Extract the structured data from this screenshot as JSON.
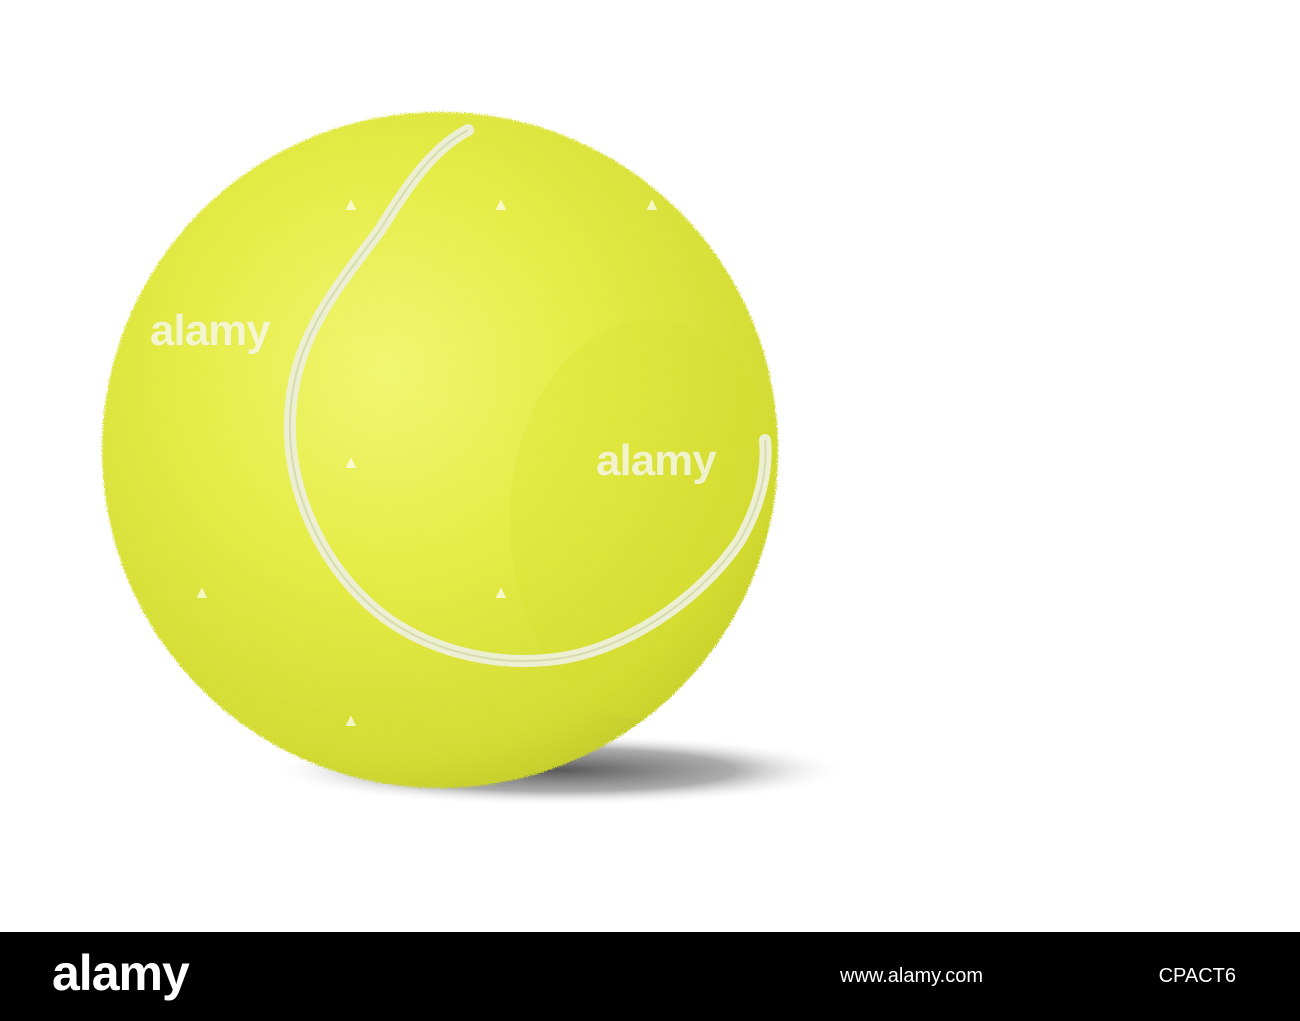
{
  "scene": {
    "subject": "tennis-ball",
    "background_color": "#ffffff",
    "ball_color": "#dde534",
    "ball_highlight_color": "#f0f56a",
    "ball_shadow_color": "#b9c21a",
    "seam_color": "#ecefd2",
    "cast_shadow_color": "#4a4a4a"
  },
  "watermarks": {
    "text_left": "alamy",
    "text_center": "alamy"
  },
  "footer": {
    "brand": "alamy",
    "site": "www.alamy.com",
    "image_id": "CPACT6",
    "background_color": "#000000",
    "text_color": "#ffffff"
  }
}
